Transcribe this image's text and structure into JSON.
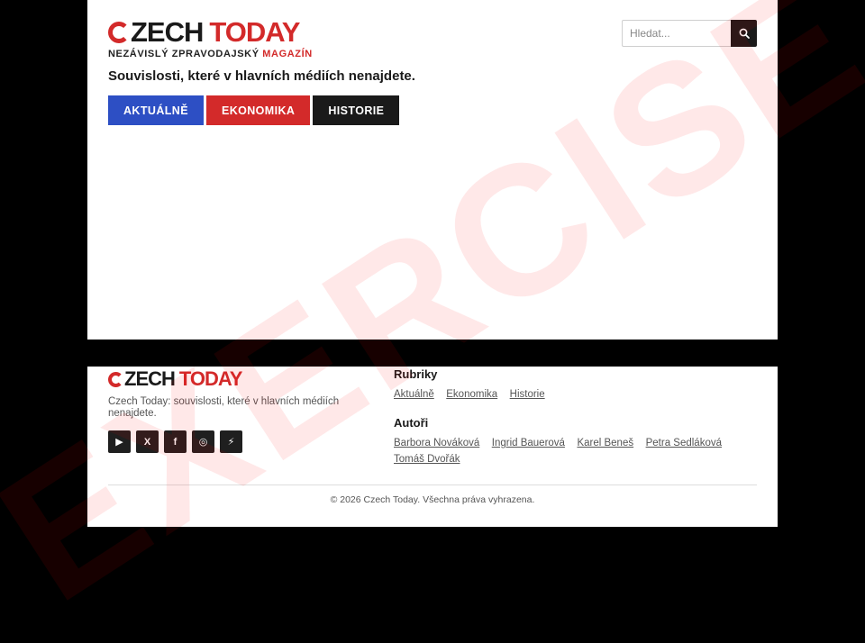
{
  "header": {
    "logo": {
      "word1": "ZECH",
      "word2": "TODAY"
    },
    "tagline": {
      "text": "NEZÁVISLÝ ZPRAVODAJSKÝ",
      "accent": "MAGAZÍN"
    },
    "slogan": "Souvislosti, které v hlavních médiích nenajdete.",
    "search": {
      "placeholder": "Hledat...",
      "icon": "search-icon"
    }
  },
  "nav": {
    "items": [
      {
        "label": "AKTUÁLNĚ",
        "color": "#2d4fc4"
      },
      {
        "label": "EKONOMIKA",
        "color": "#d32a2a"
      },
      {
        "label": "HISTORIE",
        "color": "#1a1a1a"
      }
    ]
  },
  "footer": {
    "logo": {
      "word1": "ZECH",
      "word2": "TODAY"
    },
    "description": "Czech Today: souvislosti, které v hlavních médiích nenajdete.",
    "socials": [
      {
        "icon": "youtube-icon",
        "glyph": "▶"
      },
      {
        "icon": "x-icon",
        "glyph": "X"
      },
      {
        "icon": "facebook-icon",
        "glyph": "f"
      },
      {
        "icon": "instagram-icon",
        "glyph": "◎"
      },
      {
        "icon": "lightning-icon",
        "glyph": "⚡"
      }
    ],
    "rubriky": {
      "heading": "Rubriky",
      "links": [
        "Aktuálně",
        "Ekonomika",
        "Historie"
      ]
    },
    "autori": {
      "heading": "Autoři",
      "links": [
        "Barbora Nováková",
        "Ingrid Bauerová",
        "Karel Beneš",
        "Petra Sedláková",
        "Tomáš Dvořák"
      ]
    },
    "copyright": "© 2026 Czech Today. Všechna práva vyhrazena."
  },
  "watermark": "EXERCISE",
  "colors": {
    "brand_red": "#d32a2a",
    "brand_blue": "#2d4fc4",
    "dark": "#1a1a1a"
  }
}
